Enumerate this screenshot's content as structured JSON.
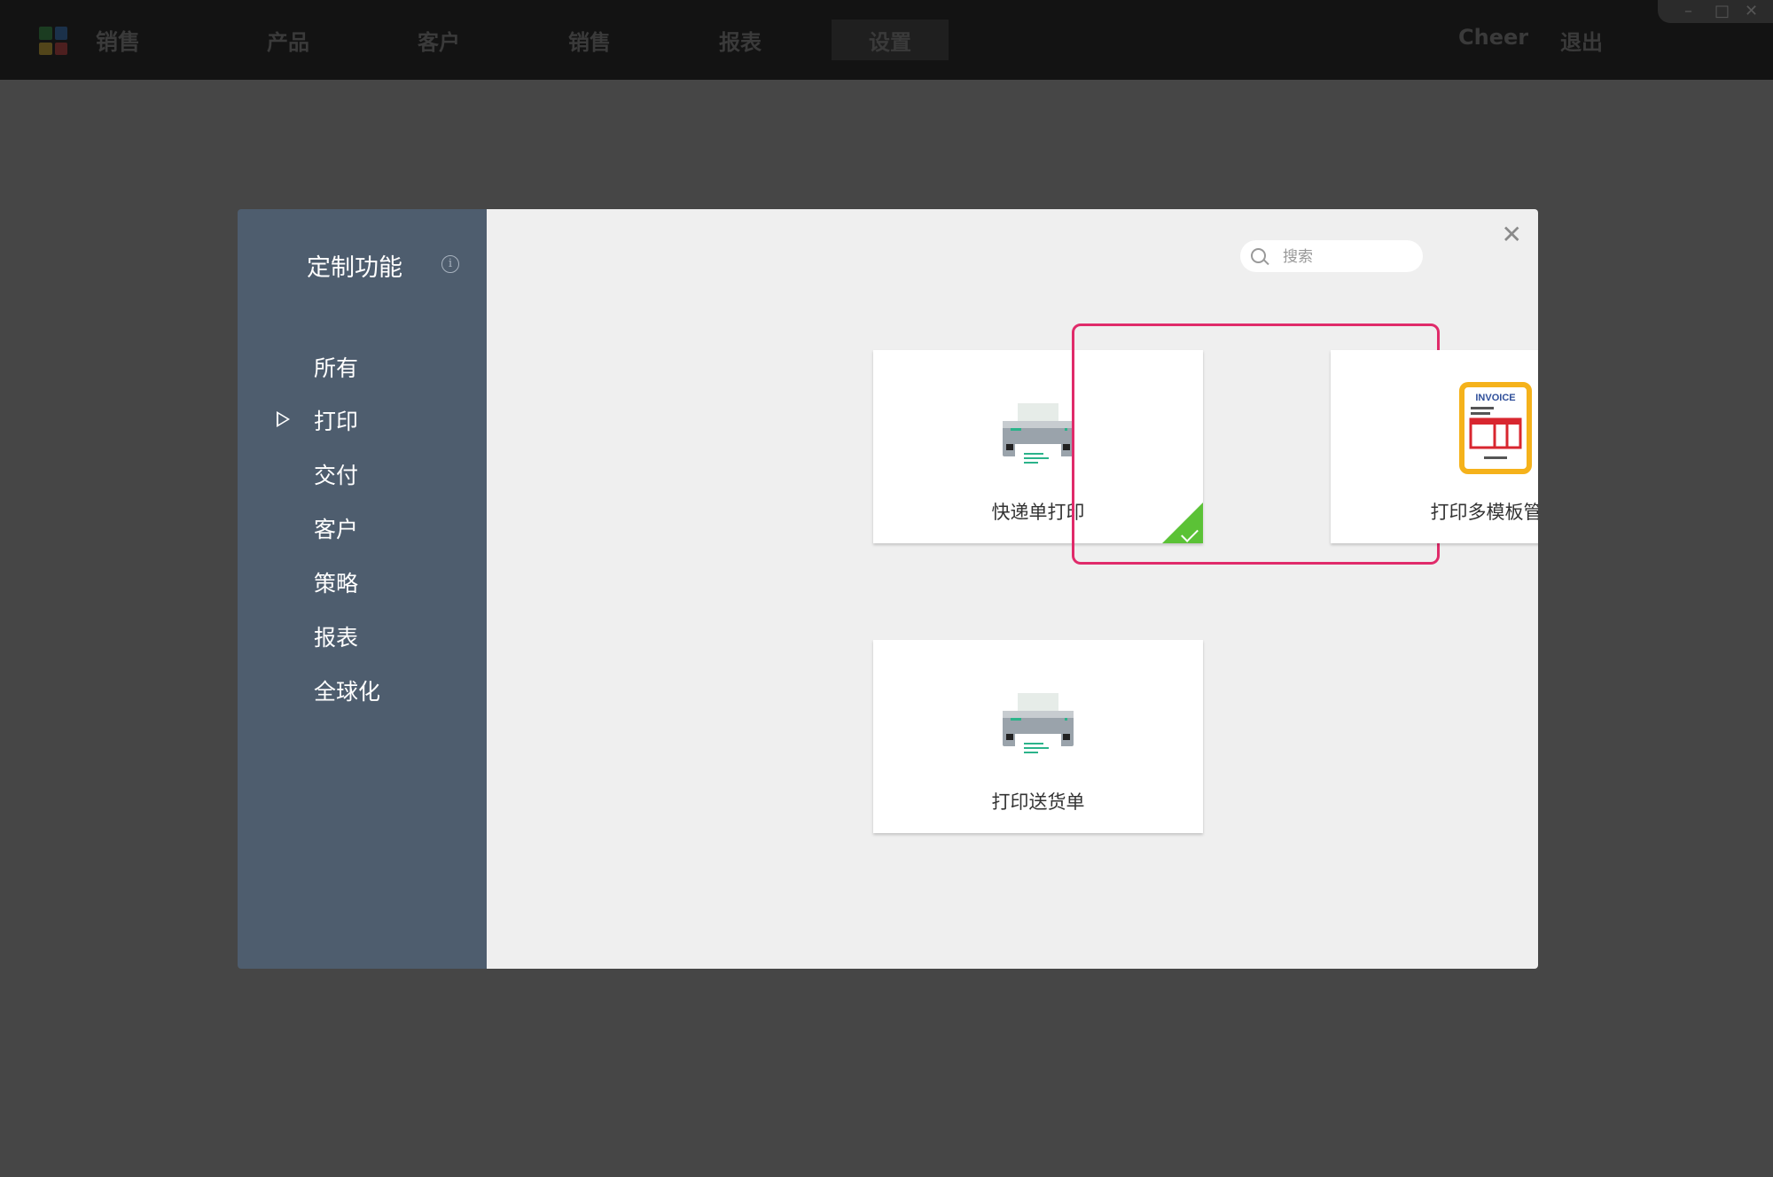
{
  "topbar": {
    "brand": "销售",
    "nav": [
      "产品",
      "客户",
      "销售",
      "报表",
      "设置"
    ],
    "active_nav": "设置",
    "user": "Cheer",
    "logout": "退出"
  },
  "sidebar": {
    "title": "定制功能",
    "items": [
      {
        "label": "所有",
        "active": false
      },
      {
        "label": "打印",
        "active": true
      },
      {
        "label": "交付",
        "active": false
      },
      {
        "label": "客户",
        "active": false
      },
      {
        "label": "策略",
        "active": false
      },
      {
        "label": "报表",
        "active": false
      },
      {
        "label": "全球化",
        "active": false
      }
    ]
  },
  "search": {
    "placeholder": "搜索",
    "value": ""
  },
  "cards": [
    {
      "label": "快递单打印",
      "icon": "printer-icon",
      "installed": true,
      "highlighted": false
    },
    {
      "label": "打印多模板管理",
      "icon": "invoice-icon",
      "icon_text": "INVOICE",
      "installed": true,
      "highlighted": true
    },
    {
      "label": "打印送货单",
      "icon": "printer-icon",
      "installed": false,
      "highlighted": false
    }
  ],
  "colors": {
    "sidebar_bg": "#4e5d6e",
    "main_bg": "#efefef",
    "installed_badge": "#5bc236",
    "highlight": "#e02b6a",
    "invoice_border": "#f5b21b",
    "invoice_red": "#d8262f"
  }
}
